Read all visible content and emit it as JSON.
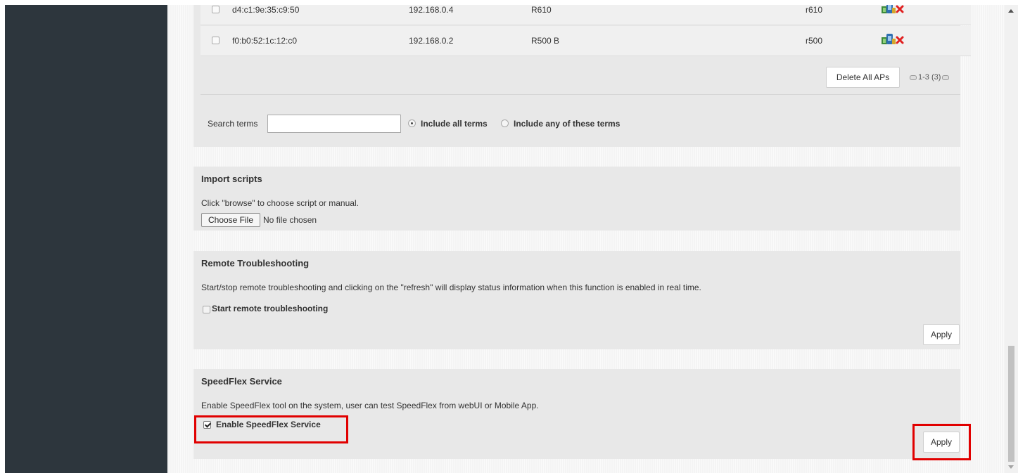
{
  "ap_table": {
    "rows": [
      {
        "mac": "d4:c1:9e:35:c9:50",
        "ip": "192.168.0.4",
        "name": "R610",
        "model": "r610"
      },
      {
        "mac": "f0:b0:52:1c:12:c0",
        "ip": "192.168.0.2",
        "name": "R500 B",
        "model": "r500"
      }
    ],
    "delete_all_label": "Delete All APs",
    "pagination": "1-3 (3)"
  },
  "search": {
    "label": "Search terms",
    "value": "",
    "option_all": "Include all terms",
    "option_any": "Include any of these terms",
    "selected": "all"
  },
  "import_scripts": {
    "title": "Import scripts",
    "description": "Click \"browse\" to choose script or manual.",
    "choose_file_label": "Choose File",
    "file_status": "No file chosen"
  },
  "remote_troubleshooting": {
    "title": "Remote Troubleshooting",
    "description": "Start/stop remote troubleshooting and clicking on the \"refresh\" will display status information when this function is enabled in real time.",
    "checkbox_label": "Start remote troubleshooting",
    "checked": false,
    "apply_label": "Apply"
  },
  "speedflex": {
    "title": "SpeedFlex Service",
    "description": "Enable SpeedFlex tool on the system, user can test SpeedFlex from webUI or Mobile App.",
    "checkbox_label": "Enable SpeedFlex Service",
    "checked": true,
    "apply_label": "Apply"
  },
  "colors": {
    "sidebar": "#2d363d",
    "highlight": "#e10000",
    "panel": "#e8e8e8"
  },
  "icons": {
    "ap_actions": [
      "ap-config-icon",
      "delete-icon"
    ],
    "pagination": [
      "page-prev-icon",
      "page-next-icon"
    ]
  }
}
